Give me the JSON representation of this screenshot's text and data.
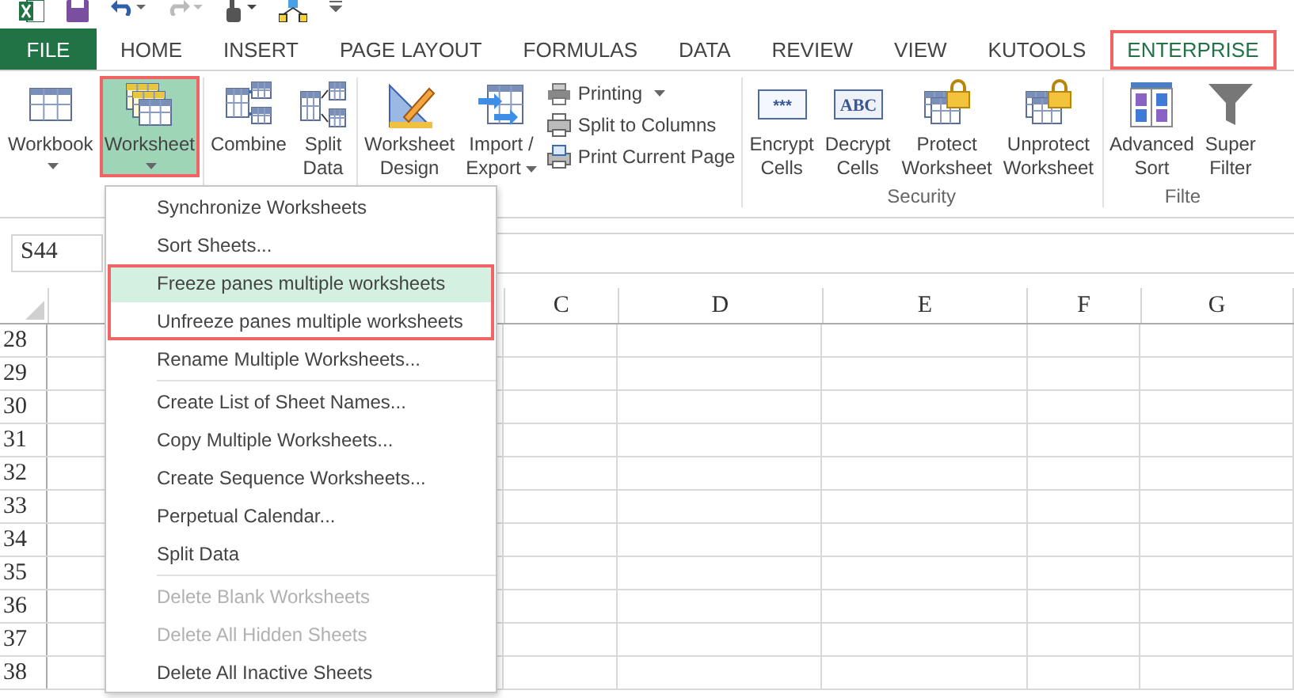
{
  "tabs": [
    {
      "label": "FILE",
      "kind": "file"
    },
    {
      "label": "HOME",
      "kind": "tab",
      "selected": false,
      "annotated": false
    },
    {
      "label": "INSERT",
      "kind": "tab",
      "selected": false,
      "annotated": false
    },
    {
      "label": "PAGE LAYOUT",
      "kind": "tab",
      "selected": false,
      "annotated": false
    },
    {
      "label": "FORMULAS",
      "kind": "tab",
      "selected": false,
      "annotated": false
    },
    {
      "label": "DATA",
      "kind": "tab",
      "selected": false,
      "annotated": false
    },
    {
      "label": "REVIEW",
      "kind": "tab",
      "selected": false,
      "annotated": false
    },
    {
      "label": "VIEW",
      "kind": "tab",
      "selected": false,
      "annotated": false
    },
    {
      "label": "KUTOOLS",
      "kind": "tab",
      "selected": false,
      "annotated": false
    },
    {
      "label": "ENTERPRISE",
      "kind": "tab",
      "selected": true,
      "annotated": true
    }
  ],
  "ribbon": {
    "groups": [
      {
        "buttons": [
          {
            "kind": "large",
            "lines": [
              "Workbook"
            ],
            "dropdown": true,
            "selected": false,
            "annotated": false
          },
          {
            "kind": "large",
            "lines": [
              "Worksheet"
            ],
            "dropdown": true,
            "selected": true,
            "annotated": true
          }
        ]
      },
      {
        "buttons": [
          {
            "kind": "large",
            "lines": [
              "Combine"
            ],
            "dropdown": false,
            "selected": false,
            "annotated": false
          },
          {
            "kind": "large",
            "lines": [
              "Split",
              "Data"
            ],
            "dropdown": false,
            "selected": false,
            "annotated": false
          }
        ]
      },
      {
        "buttons": [
          {
            "kind": "large",
            "lines": [
              "Worksheet",
              "Design"
            ],
            "dropdown": false,
            "selected": false,
            "annotated": false
          },
          {
            "kind": "large",
            "lines": [
              "Import /",
              "Export"
            ],
            "dropdown": true,
            "selected": false,
            "annotated": false
          },
          {
            "kind": "stack",
            "items": [
              {
                "label": "Printing",
                "dropdown": true
              },
              {
                "label": "Split to Columns",
                "dropdown": false
              },
              {
                "label": "Print Current Page",
                "dropdown": false
              }
            ]
          }
        ]
      },
      {
        "label": "Security",
        "buttons": [
          {
            "kind": "large",
            "lines": [
              "Encrypt",
              "Cells"
            ],
            "icon_text": "***",
            "dropdown": false,
            "selected": false,
            "annotated": false
          },
          {
            "kind": "large",
            "lines": [
              "Decrypt",
              "Cells"
            ],
            "icon_text": "ABC",
            "dropdown": false,
            "selected": false,
            "annotated": false
          },
          {
            "kind": "large",
            "lines": [
              "Protect",
              "Worksheet"
            ],
            "dropdown": false,
            "selected": false,
            "annotated": false
          },
          {
            "kind": "large",
            "lines": [
              "Unprotect",
              "Worksheet"
            ],
            "dropdown": false,
            "selected": false,
            "annotated": false
          }
        ]
      },
      {
        "label": "Filte",
        "buttons": [
          {
            "kind": "large",
            "lines": [
              "Advanced",
              "Sort"
            ],
            "dropdown": false,
            "selected": false,
            "annotated": false
          },
          {
            "kind": "large",
            "lines": [
              "Super",
              "Filter"
            ],
            "dropdown": false,
            "selected": false,
            "annotated": false
          }
        ]
      }
    ]
  },
  "name_box": "S44",
  "columns": [
    {
      "label": "C"
    },
    {
      "label": "D"
    },
    {
      "label": "E"
    },
    {
      "label": "F"
    },
    {
      "label": "G"
    }
  ],
  "rows": [
    "28",
    "29",
    "30",
    "31",
    "32",
    "33",
    "34",
    "35",
    "36",
    "37",
    "38"
  ],
  "menu": {
    "sections": [
      {
        "groups": [
          {
            "annotated": false,
            "items": [
              {
                "label": "Synchronize Worksheets",
                "selected": false,
                "disabled": false
              },
              {
                "label": "Sort Sheets...",
                "selected": false,
                "disabled": false
              }
            ]
          },
          {
            "annotated": true,
            "items": [
              {
                "label": "Freeze panes multiple worksheets",
                "selected": true,
                "disabled": false
              },
              {
                "label": "Unfreeze panes multiple worksheets",
                "selected": false,
                "disabled": false
              }
            ]
          },
          {
            "annotated": false,
            "items": [
              {
                "label": "Rename Multiple Worksheets...",
                "selected": false,
                "disabled": false
              }
            ]
          }
        ]
      },
      {
        "groups": [
          {
            "annotated": false,
            "items": [
              {
                "label": "Create List of Sheet Names...",
                "selected": false,
                "disabled": false
              },
              {
                "label": "Copy Multiple Worksheets...",
                "selected": false,
                "disabled": false
              },
              {
                "label": "Create Sequence Worksheets...",
                "selected": false,
                "disabled": false
              },
              {
                "label": "Perpetual Calendar...",
                "selected": false,
                "disabled": false
              },
              {
                "label": "Split Data",
                "selected": false,
                "disabled": false
              }
            ]
          }
        ]
      },
      {
        "groups": [
          {
            "annotated": false,
            "items": [
              {
                "label": "Delete Blank Worksheets",
                "selected": false,
                "disabled": true
              },
              {
                "label": "Delete All Hidden Sheets",
                "selected": false,
                "disabled": true
              },
              {
                "label": "Delete All Inactive Sheets",
                "selected": false,
                "disabled": false
              }
            ]
          }
        ]
      }
    ]
  }
}
